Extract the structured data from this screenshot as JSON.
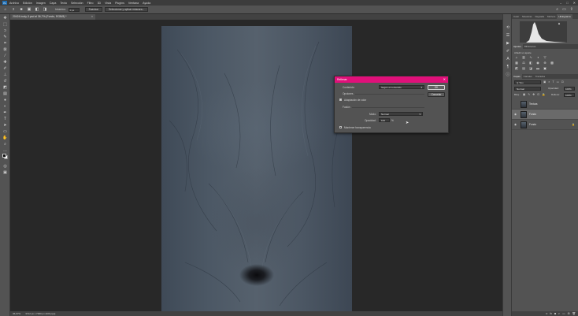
{
  "menubar": {
    "items": [
      "Archivo",
      "Edición",
      "Imagen",
      "Capa",
      "Texto",
      "Selección",
      "Filtro",
      "3D",
      "Vista",
      "Plugins",
      "Ventana",
      "Ayuda"
    ],
    "window_controls": [
      "–",
      "□",
      "✕"
    ]
  },
  "optionsbar": {
    "field_label": "Intuición:",
    "field_value": "0 px",
    "btn_subject": "Suavizar",
    "btn_select_mask": "Seleccionar y aplicar máscara..."
  },
  "document": {
    "tab_title": "20424-body-3.psd al 36,7% (Fondo, RGB/8) *",
    "tab_close": "×",
    "status_zoom": "36,67%",
    "status_size": "3712 px x 7000 px (300 ppp)"
  },
  "dialog": {
    "title": "Rellenar",
    "close": "✕",
    "contents_label": "Contenido:",
    "contents_value": "Según el contenido",
    "ok": "OK",
    "cancel": "Cancelar",
    "options_heading": "Opciones",
    "color_adapt_label": "Adaptación de color",
    "fusion_heading": "Fusión",
    "mode_label": "Modo:",
    "mode_value": "Normal",
    "opacity_label": "Opacidad:",
    "opacity_value": "100",
    "opacity_unit": "%",
    "preserve_label": "Mantener transparencia"
  },
  "panels": {
    "top_tabs": [
      "Color",
      "Muestras",
      "Degrada",
      "Motivos",
      "Histograma"
    ],
    "adj_tabs": [
      "Ajustes",
      "Bibliotecas"
    ],
    "adj_label": "Añadir un ajuste",
    "layers_tabs": [
      "Capas",
      "Canales",
      "Trazados"
    ],
    "filter_value": "Q Tipo",
    "blend_value": "Normal",
    "opacity_label": "Opacidad:",
    "opacity_value": "100%",
    "lock_label": "Bloq.:",
    "fill_label": "Relleno:",
    "fill_value": "100%",
    "layers": [
      {
        "name": "Textura"
      },
      {
        "name": "Fondo"
      },
      {
        "name": "Fondo"
      }
    ]
  },
  "colors": {
    "dialog_title_bar": "#e0107a",
    "canvas_bg": "#282828",
    "ui_bg": "#535353"
  }
}
